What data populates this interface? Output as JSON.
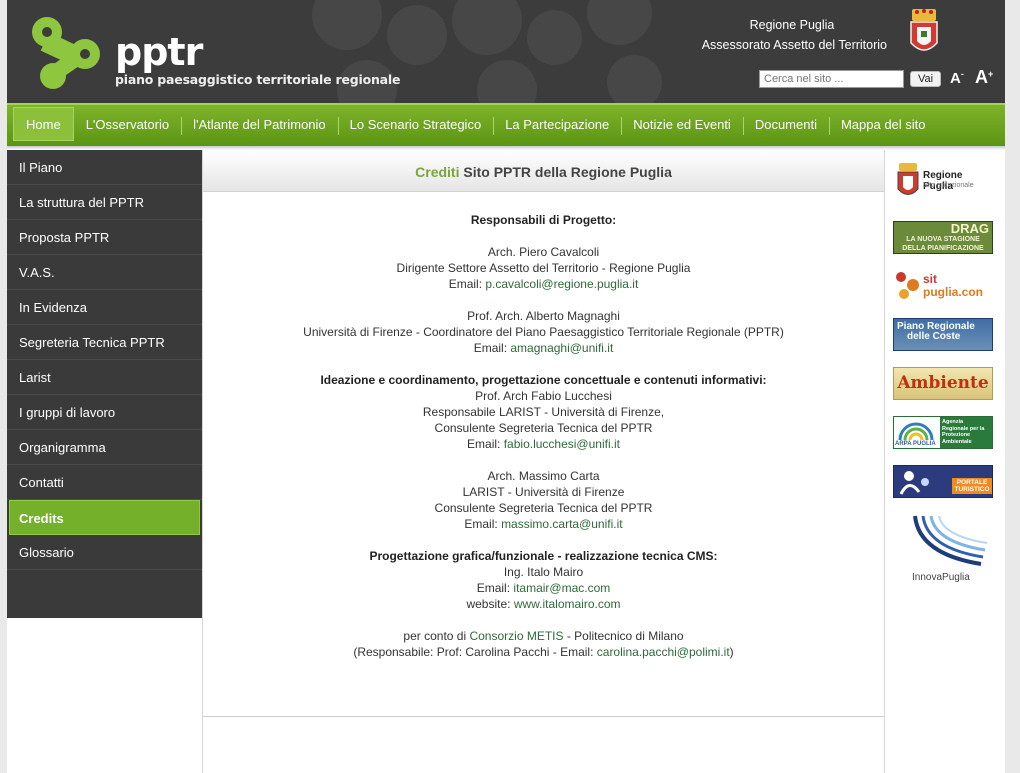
{
  "header": {
    "logo_text": "pptr",
    "logo_subtitle": "piano paesaggistico territoriale regionale",
    "region_name": "Regione Puglia",
    "region_office": "Assessorato Assetto del Territorio",
    "search_placeholder": "Cerca nel sito ...",
    "search_button": "Vai",
    "font_decrease": "A",
    "font_increase": "A",
    "font_decrease_sign": "-",
    "font_increase_sign": "+"
  },
  "nav": {
    "items": [
      {
        "label": "Home"
      },
      {
        "label": "L'Osservatorio"
      },
      {
        "label": "l'Atlante del Patrimonio"
      },
      {
        "label": "Lo Scenario Strategico"
      },
      {
        "label": "La Partecipazione"
      },
      {
        "label": "Notizie ed Eventi"
      },
      {
        "label": "Documenti"
      },
      {
        "label": "Mappa del sito"
      }
    ]
  },
  "sidebar": {
    "items": [
      {
        "label": "Il Piano"
      },
      {
        "label": "La struttura del PPTR"
      },
      {
        "label": "Proposta PPTR"
      },
      {
        "label": "V.A.S."
      },
      {
        "label": "In Evidenza"
      },
      {
        "label": "Segreteria Tecnica PPTR"
      },
      {
        "label": "Larist"
      },
      {
        "label": "I gruppi di lavoro"
      },
      {
        "label": "Organigramma"
      },
      {
        "label": "Contatti"
      },
      {
        "label": "Credits"
      },
      {
        "label": "Glossario"
      }
    ]
  },
  "page": {
    "title_highlight": "Crediti",
    "title_rest": "Sito PPTR della Regione Puglia"
  },
  "credits": {
    "resp_heading": "Responsabili di Progetto:",
    "p1_name": "Arch. Piero Cavalcoli",
    "p1_role": "Dirigente Settore Assetto del Territorio - Regione Puglia",
    "p1_email_label": "Email: ",
    "p1_email": "p.cavalcoli@regione.puglia.it",
    "p2_name": "Prof. Arch. Alberto Magnaghi",
    "p2_role": "Università di Firenze - Coordinatore del Piano Paesaggistico Territoriale Regionale (PPTR)",
    "p2_email_label": "Email: ",
    "p2_email": "amagnaghi@unifi.it",
    "idea_heading": "Ideazione e coordinamento, progettazione concettuale e contenuti informativi:",
    "p3_name": "Prof. Arch Fabio Lucchesi",
    "p3_role1": "Responsabile LARIST - Università di Firenze,",
    "p3_role2": "Consulente Segreteria Tecnica del PPTR",
    "p3_email_label": "Email: ",
    "p3_email": "fabio.lucchesi@unifi.it",
    "p4_name": "Arch. Massimo Carta",
    "p4_role1": "LARIST - Università di Firenze",
    "p4_role2": "Consulente Segreteria Tecnica del PPTR",
    "p4_email_label": "Email: ",
    "p4_email": "massimo.carta@unifi.it",
    "graf_heading": "Progettazione grafica/funzionale - realizzazione tecnica CMS:",
    "p5_name": "Ing. Italo Mairo",
    "p5_email_label": "Email: ",
    "p5_email": "itamair@mac.com",
    "p5_web_label": "website: ",
    "p5_web": "www.italomairo.com",
    "conto_prefix": "per conto di ",
    "conto_link": "Consorzio METIS",
    "conto_suffix": " - Politecnico di Milano",
    "resp_prefix": "(Responsabile: Prof: Carolina Pacchi - Email: ",
    "resp_link": "carolina.pacchi@polimi.it",
    "resp_suffix": ")"
  },
  "right_banners": {
    "regione_title": "Regione Puglia",
    "regione_sub": "Sito istituzionale",
    "drag_title": "DRAG",
    "drag_sub1": "LA NUOVA STAGIONE",
    "drag_sub2": "DELLA PIANIFICAZIONE",
    "sit_line1": "sit",
    "sit_line2": "puglia.con",
    "coste_line1": "Piano Regionale",
    "coste_line2": "delle Coste",
    "ambiente": "Ambiente",
    "arpa_logo": "ARPA PUGLIA",
    "arpa_text": "Agenzia Regionale per la Protezione Ambientale",
    "turismo_text": "PORTALE TURISTICO",
    "innova": "InnovaPuglia"
  },
  "colors": {
    "accent_green": "#74b02a",
    "header_bg": "#3c3c3c",
    "sidebar_bg": "#3a3a3a",
    "link_green": "#2f6a38"
  }
}
